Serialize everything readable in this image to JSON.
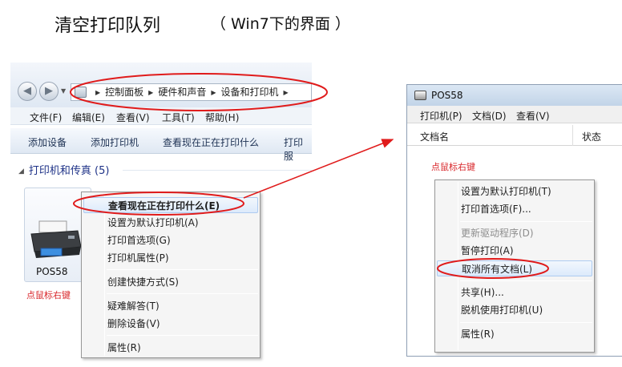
{
  "title": "清空打印队列",
  "subtitle": "（ Win7下的界面 ）",
  "explorer": {
    "breadcrumbs": [
      "控制面板",
      "硬件和声音",
      "设备和打印机"
    ],
    "menu": [
      "文件(F)",
      "编辑(E)",
      "查看(V)",
      "工具(T)",
      "帮助(H)"
    ],
    "toolbar": [
      "添加设备",
      "添加打印机",
      "查看现在正在打印什么",
      "打印服"
    ],
    "group_header": "打印机和传真 (5)",
    "device_name": "POS58"
  },
  "left_menu": {
    "items": [
      {
        "label": "查看现在正在打印什么(E)",
        "bold": true,
        "highlighted": true
      },
      {
        "label": "设置为默认打印机(A)"
      },
      {
        "label": "打印首选项(G)"
      },
      {
        "label": "打印机属性(P)"
      },
      {
        "label": "创建快捷方式(S)"
      },
      {
        "label": "疑难解答(T)"
      },
      {
        "label": "删除设备(V)"
      },
      {
        "label": "属性(R)"
      }
    ]
  },
  "queue_window": {
    "title": "POS58",
    "menu": [
      "打印机(P)",
      "文档(D)",
      "查看(V)"
    ],
    "columns": [
      "文档名",
      "状态"
    ]
  },
  "right_menu": {
    "items": [
      {
        "label": "设置为默认打印机(T)"
      },
      {
        "label": "打印首选项(F)..."
      },
      {
        "label": "更新驱动程序(D)",
        "disabled": true
      },
      {
        "label": "暂停打印(A)"
      },
      {
        "label": "取消所有文档(L)",
        "highlighted": true
      },
      {
        "label": "共享(H)..."
      },
      {
        "label": "脱机使用打印机(U)"
      },
      {
        "label": "属性(R)"
      }
    ]
  },
  "notes": {
    "left": "点鼠标右键",
    "right": "点鼠标右键"
  },
  "colors": {
    "annotation_red": "#e01b1b",
    "title_blue": "#1e3287"
  }
}
